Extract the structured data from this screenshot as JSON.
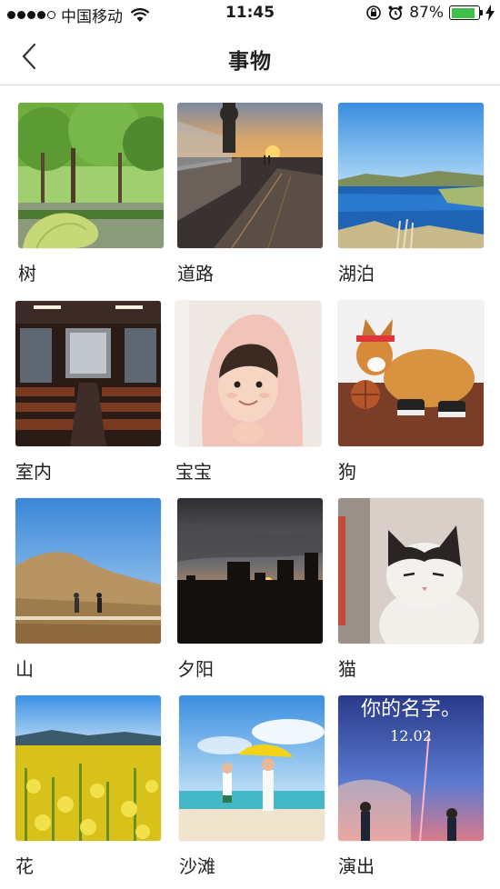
{
  "status_bar": {
    "carrier": "中国移动",
    "time": "11:45",
    "battery_percent": "87%",
    "battery_level": 0.87,
    "signal_bars_filled": 4,
    "signal_bars_total": 5
  },
  "header": {
    "title": "事物",
    "back_icon": "chevron-left-icon"
  },
  "categories": [
    {
      "label": "树"
    },
    {
      "label": "道路"
    },
    {
      "label": "湖泊"
    },
    {
      "label": "室内"
    },
    {
      "label": "宝宝"
    },
    {
      "label": "狗"
    },
    {
      "label": "山"
    },
    {
      "label": "夕阳"
    },
    {
      "label": "猫"
    },
    {
      "label": "花"
    },
    {
      "label": "沙滩"
    },
    {
      "label": "演出"
    }
  ],
  "poster_text": {
    "title": "你的名字。",
    "date": "12.02"
  },
  "colors": {
    "battery": "#3ec04a",
    "divider": "#d9d9d9"
  }
}
